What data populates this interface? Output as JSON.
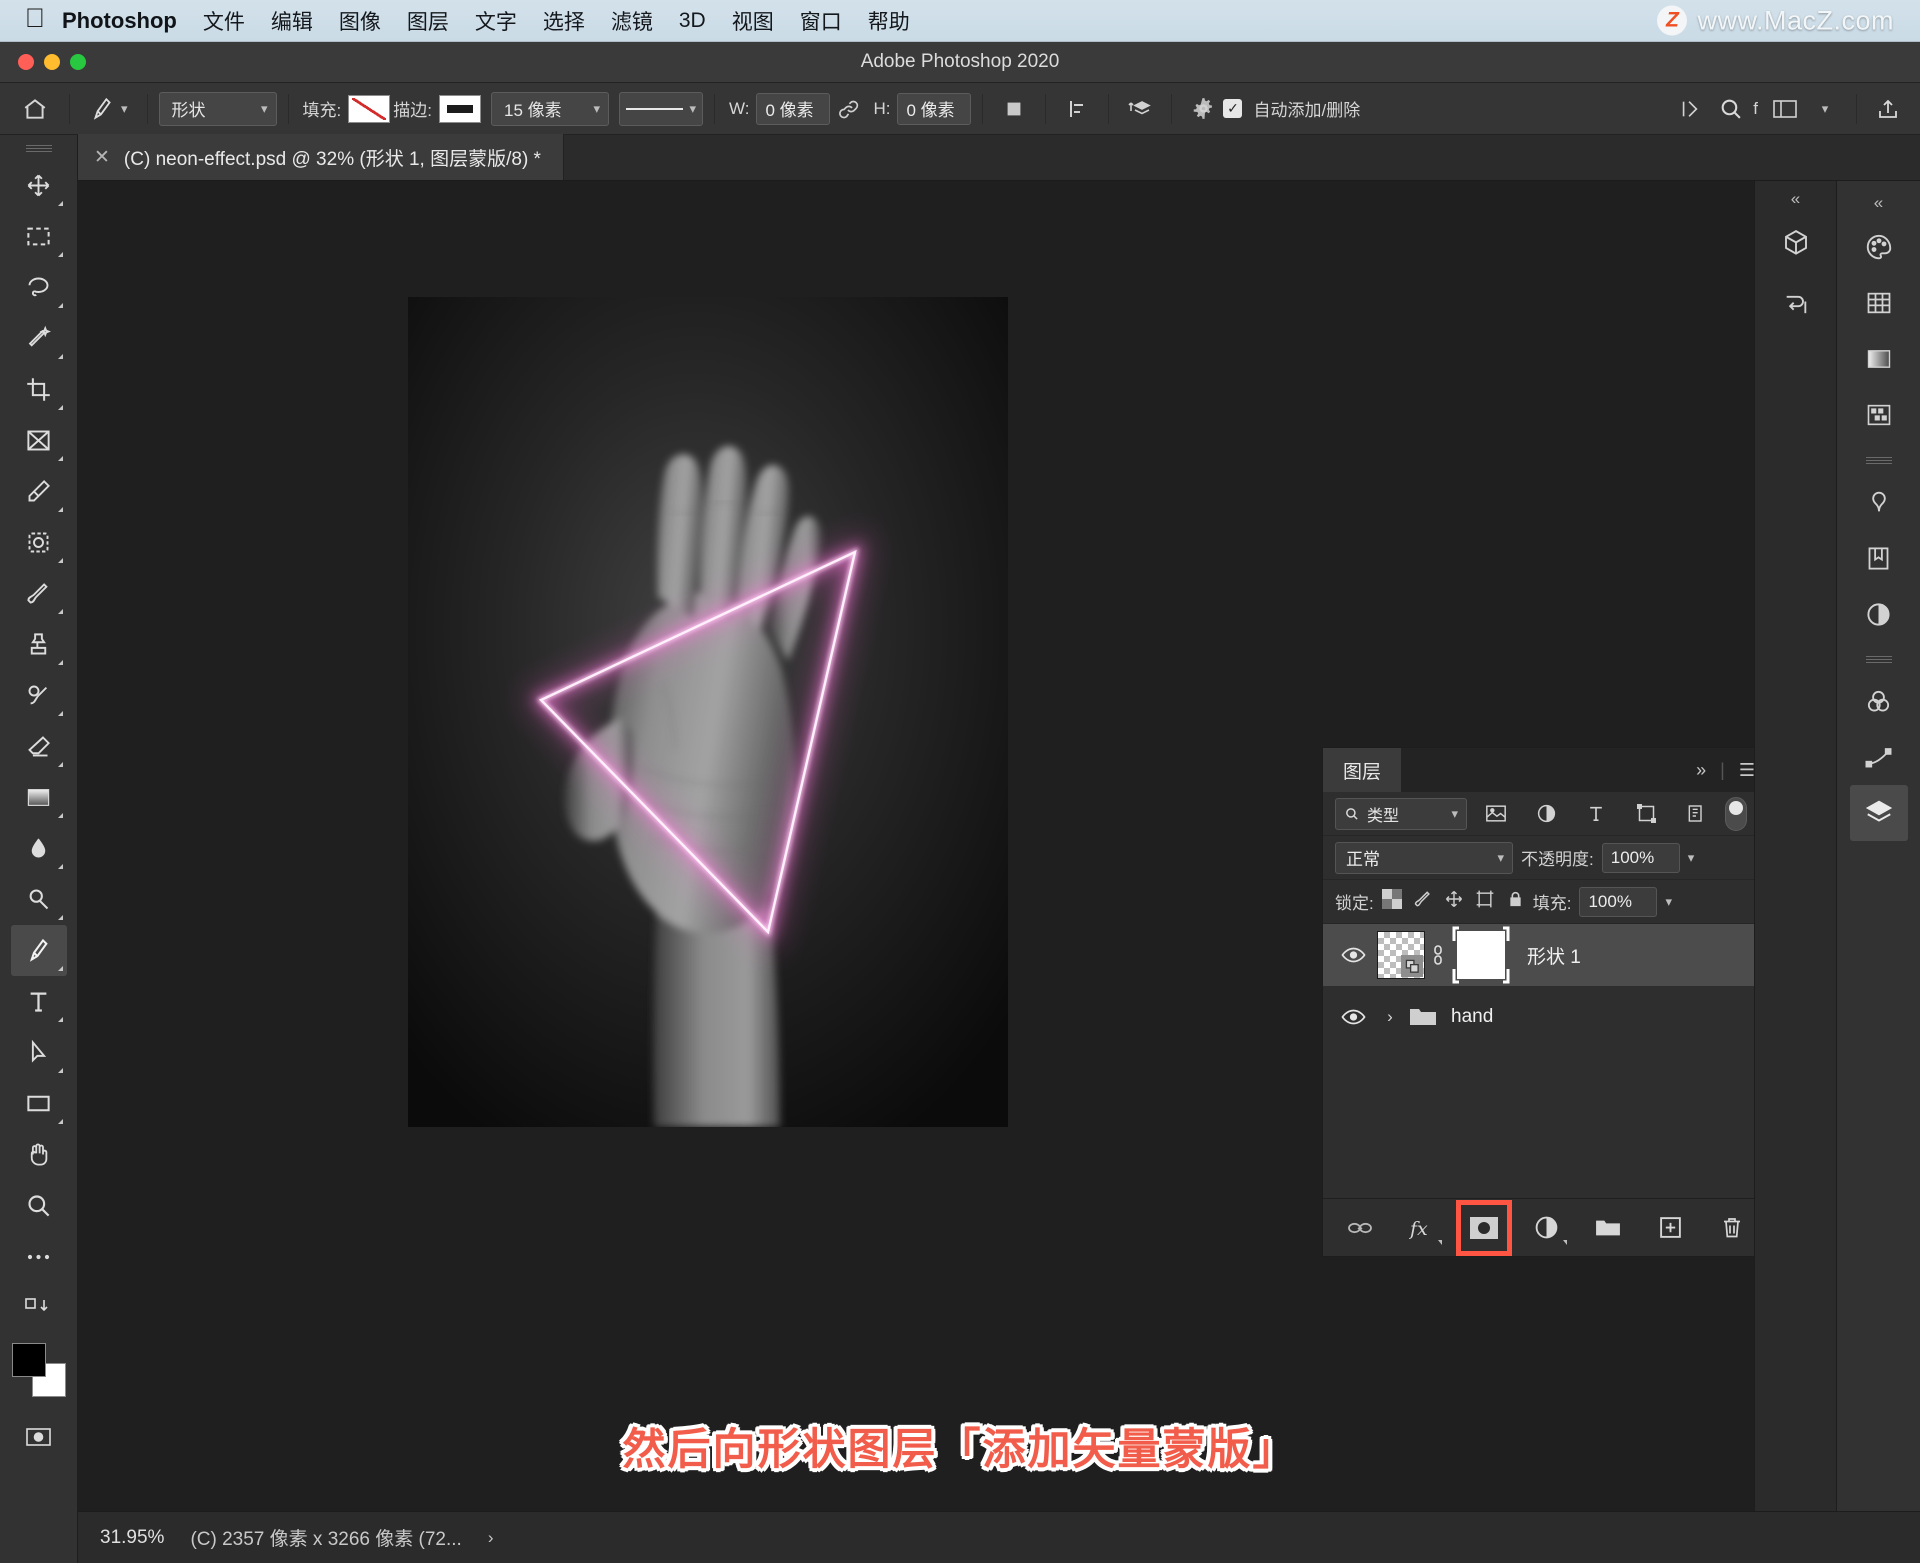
{
  "mac_menu": {
    "apple_icon": "apple-logo-icon",
    "app_name": "Photoshop",
    "items": [
      "文件",
      "编辑",
      "图像",
      "图层",
      "文字",
      "选择",
      "滤镜",
      "3D",
      "视图",
      "窗口",
      "帮助"
    ],
    "watermark_badge": "Z",
    "watermark_text": "www.MacZ.com"
  },
  "titlebar": {
    "title": "Adobe Photoshop 2020"
  },
  "options_bar": {
    "home_icon": "home-icon",
    "tool_icon": "pen-tool-icon",
    "mode_select": "形状",
    "fill_label": "填充:",
    "stroke_label": "描边:",
    "stroke_width": "15 像素",
    "width_label": "W:",
    "width_value": "0 像素",
    "link_icon": "link-icon",
    "height_label": "H:",
    "height_value": "0 像素",
    "path_op_icon": "path-operations-icon",
    "align_icon": "path-alignment-icon",
    "arrange_icon": "path-arrangement-icon",
    "gear_icon": "gear-icon",
    "auto_add_delete_label": "自动添加/删除",
    "auto_add_delete_checked": true,
    "mask_icon": "mask-icon",
    "search_icon": "search-icon",
    "f_label": "f",
    "workspace_icon": "workspace-icon",
    "share_icon": "share-icon"
  },
  "tab": {
    "close_icon": "close-icon",
    "title": "(C) neon-effect.psd @ 32% (形状 1, 图层蒙版/8) *"
  },
  "toolbar": {
    "tools": [
      {
        "name": "move-tool",
        "icon": "move-icon"
      },
      {
        "name": "marquee-tool",
        "icon": "rect-marquee-icon"
      },
      {
        "name": "lasso-tool",
        "icon": "lasso-icon"
      },
      {
        "name": "quick-select-tool",
        "icon": "magic-wand-icon"
      },
      {
        "name": "crop-tool",
        "icon": "crop-icon"
      },
      {
        "name": "frame-tool",
        "icon": "frame-icon"
      },
      {
        "name": "eyedropper-tool",
        "icon": "eyedropper-icon"
      },
      {
        "name": "spot-healing-tool",
        "icon": "healing-brush-icon"
      },
      {
        "name": "brush-tool",
        "icon": "brush-icon"
      },
      {
        "name": "clone-stamp-tool",
        "icon": "clone-stamp-icon"
      },
      {
        "name": "history-brush-tool",
        "icon": "history-brush-icon"
      },
      {
        "name": "eraser-tool",
        "icon": "eraser-icon"
      },
      {
        "name": "gradient-tool",
        "icon": "gradient-icon"
      },
      {
        "name": "blur-tool",
        "icon": "blur-drop-icon"
      },
      {
        "name": "dodge-tool",
        "icon": "dodge-icon"
      },
      {
        "name": "pen-tool",
        "icon": "pen-icon"
      },
      {
        "name": "type-tool",
        "icon": "type-t-icon"
      },
      {
        "name": "path-selection-tool",
        "icon": "path-arrow-icon"
      },
      {
        "name": "rectangle-tool",
        "icon": "rectangle-icon"
      },
      {
        "name": "hand-tool",
        "icon": "hand-icon"
      },
      {
        "name": "zoom-tool",
        "icon": "zoom-magnifier-icon"
      },
      {
        "name": "more-tools",
        "icon": "ellipsis-icon"
      },
      {
        "name": "edit-toolbar",
        "icon": "edit-toolbar-icon"
      }
    ],
    "foreground_color": "#000000",
    "background_color": "#ffffff",
    "quick-mask": "quick-mask-icon"
  },
  "layers_panel": {
    "tab_label": "图层",
    "expand_icon": "double-chevron-icon",
    "menu_icon": "panel-menu-icon",
    "filter": {
      "search_icon": "search-icon",
      "value": "类型",
      "icons": [
        "pixel-filter-icon",
        "adjustment-filter-icon",
        "type-filter-icon",
        "shape-filter-icon",
        "smart-object-filter-icon"
      ],
      "toggle": "filter-toggle"
    },
    "blend_mode": "正常",
    "opacity_label": "不透明度:",
    "opacity_value": "100%",
    "lock_label": "锁定:",
    "lock_icons": [
      "lock-transparent-icon",
      "lock-image-icon",
      "lock-position-icon",
      "lock-artboard-icon",
      "lock-all-icon"
    ],
    "fill_label": "填充:",
    "fill_value": "100%",
    "layers": [
      {
        "name": "形状 1",
        "visible": true,
        "selected": true,
        "has_vector_mask": true,
        "type": "shape",
        "eye_icon": "eye-icon",
        "link_icon": "mask-link-icon"
      },
      {
        "name": "hand",
        "visible": true,
        "selected": false,
        "type": "group",
        "expanded": false,
        "eye_icon": "eye-icon",
        "disclosure_icon": "chevron-right-icon",
        "folder_icon": "folder-icon"
      }
    ],
    "bottom_buttons": [
      {
        "name": "link-layers-button",
        "icon": "link-chain-icon",
        "highlighted": false
      },
      {
        "name": "layer-style-button",
        "icon": "fx-icon",
        "highlighted": false
      },
      {
        "name": "add-layer-mask-button",
        "icon": "add-mask-icon",
        "highlighted": true
      },
      {
        "name": "adjustment-layer-button",
        "icon": "half-circle-icon",
        "highlighted": false
      },
      {
        "name": "new-group-button",
        "icon": "folder-icon",
        "highlighted": false
      },
      {
        "name": "new-layer-button",
        "icon": "plus-square-icon",
        "highlighted": false
      },
      {
        "name": "delete-layer-button",
        "icon": "trash-icon",
        "highlighted": false
      }
    ],
    "highlight_color": "#ff5542"
  },
  "right_rail": {
    "collapse_icon": "double-chevron-icon",
    "mid_buttons": [
      "3d-panel-icon",
      "timeline-panel-icon"
    ],
    "buttons": [
      "color-panel-icon",
      "swatches-panel-icon",
      "gradients-panel-icon",
      "patterns-panel-icon",
      "adjustments-panel-icon",
      "libraries-panel-icon",
      "properties-panel-icon",
      "channels-panel-icon",
      "paths-panel-icon",
      "layers-panel-icon"
    ]
  },
  "canvas": {
    "document_width": 600,
    "document_height": 830,
    "neon_color": "#f07fe0",
    "subject": "hand-photo"
  },
  "caption": {
    "text": "然后向形状图层「添加矢量蒙版」",
    "color": "#f25c4a"
  },
  "status_bar": {
    "zoom": "31.95%",
    "doc_info": "(C) 2357 像素 x 3266 像素 (72...",
    "arrow_icon": "chevron-right-icon"
  }
}
